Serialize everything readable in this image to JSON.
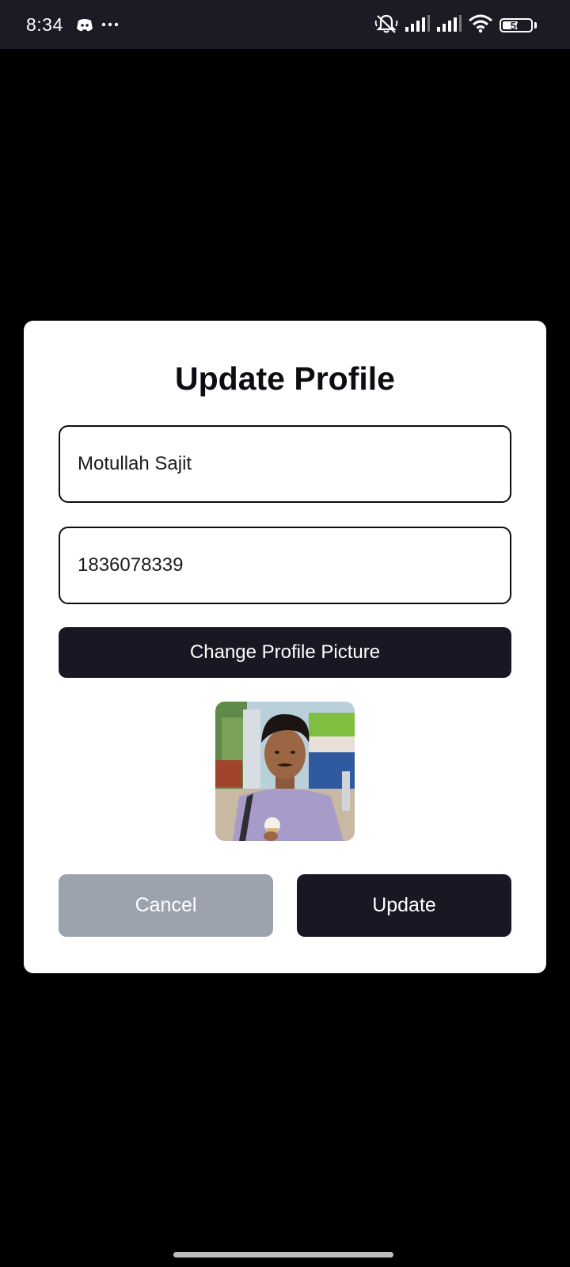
{
  "status_bar": {
    "time": "8:34",
    "battery_level": "56",
    "battery_fraction": 0.56,
    "icons": [
      "discord-icon",
      "more-dots-icon",
      "silent-bell-icon",
      "signal-icon",
      "signal-icon",
      "wifi-icon",
      "battery-icon"
    ]
  },
  "dialog": {
    "title": "Update Profile",
    "name_value": "Motullah Sajit",
    "phone_value": "1836078339",
    "change_picture_label": "Change Profile Picture",
    "cancel_label": "Cancel",
    "update_label": "Update"
  },
  "colors": {
    "primary_button": "#181824",
    "cancel_button": "#9ca3af",
    "status_bar_bg": "#1b1b26",
    "dialog_bg": "#ffffff",
    "backdrop": "#000000"
  }
}
